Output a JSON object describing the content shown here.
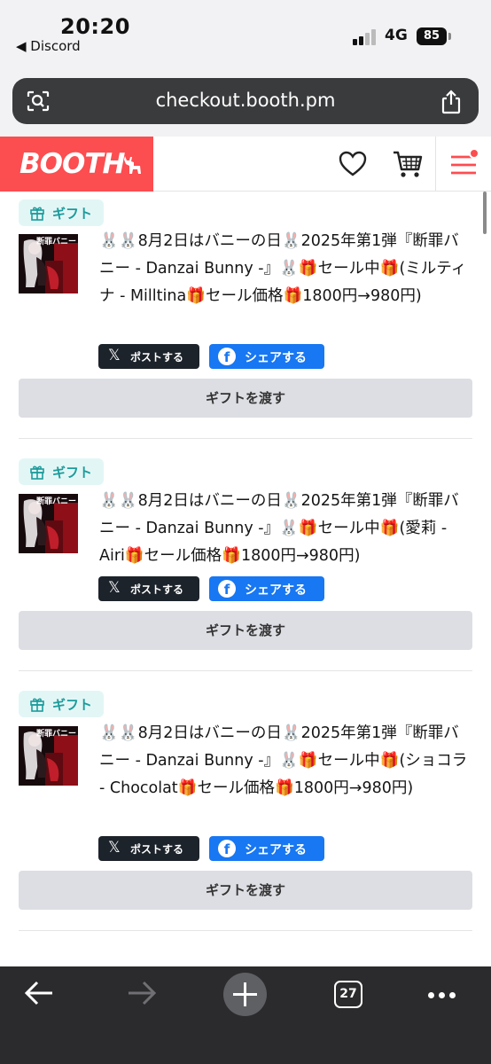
{
  "status_bar": {
    "time": "20:20",
    "back_label": "◀ Discord",
    "network": "4G",
    "battery": "85"
  },
  "browser": {
    "url": "checkout.booth.pm"
  },
  "header": {
    "logo": "BOOTH",
    "accent_color": "#fc4d50"
  },
  "gifts": [
    {
      "badge": "ギフト",
      "thumbnail_title": "断罪バニー",
      "title": "🐰🐰8月2日はバニーの日🐰2025年第1弾『断罪バニー - Danzai Bunny -』🐰🎁セール中🎁(ミルティナ - Milltina🎁セール価格🎁1800円→980円)",
      "post_label": "ポストする",
      "share_label": "シェアする",
      "give_label": "ギフトを渡す"
    },
    {
      "badge": "ギフト",
      "thumbnail_title": "断罪バニー",
      "title": "🐰🐰8月2日はバニーの日🐰2025年第1弾『断罪バニー - Danzai Bunny -』🐰🎁セール中🎁(愛莉 - Airi🎁セール価格🎁1800円→980円)",
      "post_label": "ポストする",
      "share_label": "シェアする",
      "give_label": "ギフトを渡す"
    },
    {
      "badge": "ギフト",
      "thumbnail_title": "断罪バニー",
      "title": "🐰🐰8月2日はバニーの日🐰2025年第1弾『断罪バニー - Danzai Bunny -』🐰🎁セール中🎁(ショコラ - Chocolat🎁セール価格🎁1800円→980円)",
      "post_label": "ポストする",
      "share_label": "シェアする",
      "give_label": "ギフトを渡す"
    }
  ],
  "toolbar": {
    "tab_count": "27"
  }
}
